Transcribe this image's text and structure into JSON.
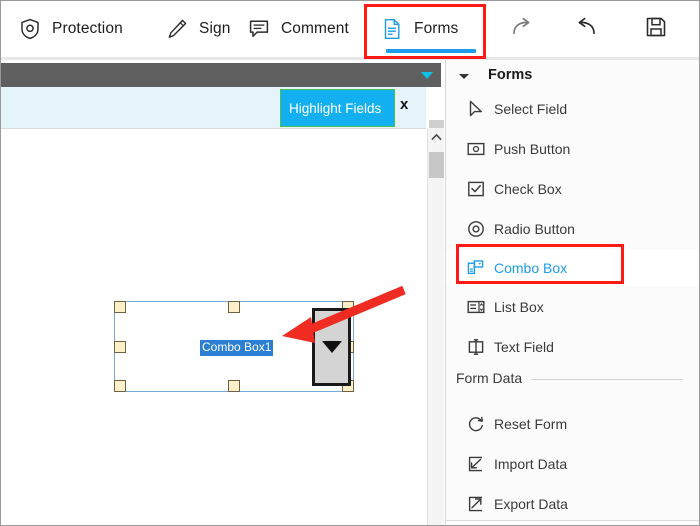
{
  "toolbar": {
    "items": [
      {
        "label": "Protection",
        "icon": "shield-icon",
        "active": false
      },
      {
        "label": "Sign",
        "icon": "pen-icon",
        "active": false
      },
      {
        "label": "Comment",
        "icon": "comment-icon",
        "active": false
      },
      {
        "label": "Forms",
        "icon": "forms-document-icon",
        "active": true
      }
    ],
    "actions": [
      {
        "name": "redo-button",
        "icon": "redo-arrow-icon"
      },
      {
        "name": "undo-button",
        "icon": "undo-arrow-icon"
      },
      {
        "name": "save-button",
        "icon": "floppy-disk-save-icon"
      }
    ],
    "active_tab": "Forms",
    "active_underline_color": "#1e9bea"
  },
  "annotations": {
    "highlight_color": "#ff1a15",
    "forms_tab_box": "red rectangle around Forms tab",
    "combo_box_item_box": "red rectangle around Combo Box menu item",
    "arrow": "red arrow pointing from Combo Box menu item to the combo box dropdown button in the document"
  },
  "document": {
    "toolbar_caret": "dropdown-caret-icon",
    "highlight_fields_button": {
      "label": "Highlight Fields",
      "background": "#12b0f0",
      "border": "#4cbf4c",
      "text_color": "#ffffff"
    },
    "close_label": "x",
    "band_color": "#e5f3fb",
    "dark_bar_color": "#5f5f5f",
    "field": {
      "name": "Combo Box1",
      "label_background": "#2a7fd4",
      "label_color": "#ffffff",
      "dropdown_icon": "dropdown-triangle-icon",
      "selection_border": "#7aa9d8",
      "handle_fill": "#fdefc8"
    },
    "scrollbar": {
      "up_arrow": "scroll-up-arrow-icon"
    }
  },
  "sidebar": {
    "panel_title": "Forms",
    "collapse_icon": "chevron-down-icon",
    "items": [
      {
        "label": "Select Field",
        "icon": "cursor-arrow-icon",
        "selected": false
      },
      {
        "label": "Push Button",
        "icon": "push-button-icon",
        "selected": false
      },
      {
        "label": "Check Box",
        "icon": "check-box-icon",
        "selected": false
      },
      {
        "label": "Radio Button",
        "icon": "radio-button-icon",
        "selected": false
      },
      {
        "label": "Combo Box",
        "icon": "combo-box-icon",
        "selected": true
      },
      {
        "label": "List Box",
        "icon": "list-box-icon",
        "selected": false
      },
      {
        "label": "Text Field",
        "icon": "text-field-icon",
        "selected": false
      }
    ],
    "section": {
      "label": "Form Data"
    },
    "data_items": [
      {
        "label": "Reset Form",
        "icon": "reset-circular-arrow-icon"
      },
      {
        "label": "Import Data",
        "icon": "import-arrow-icon"
      },
      {
        "label": "Export Data",
        "icon": "export-arrow-icon"
      }
    ],
    "selected_item_color": "#1e9bea"
  }
}
